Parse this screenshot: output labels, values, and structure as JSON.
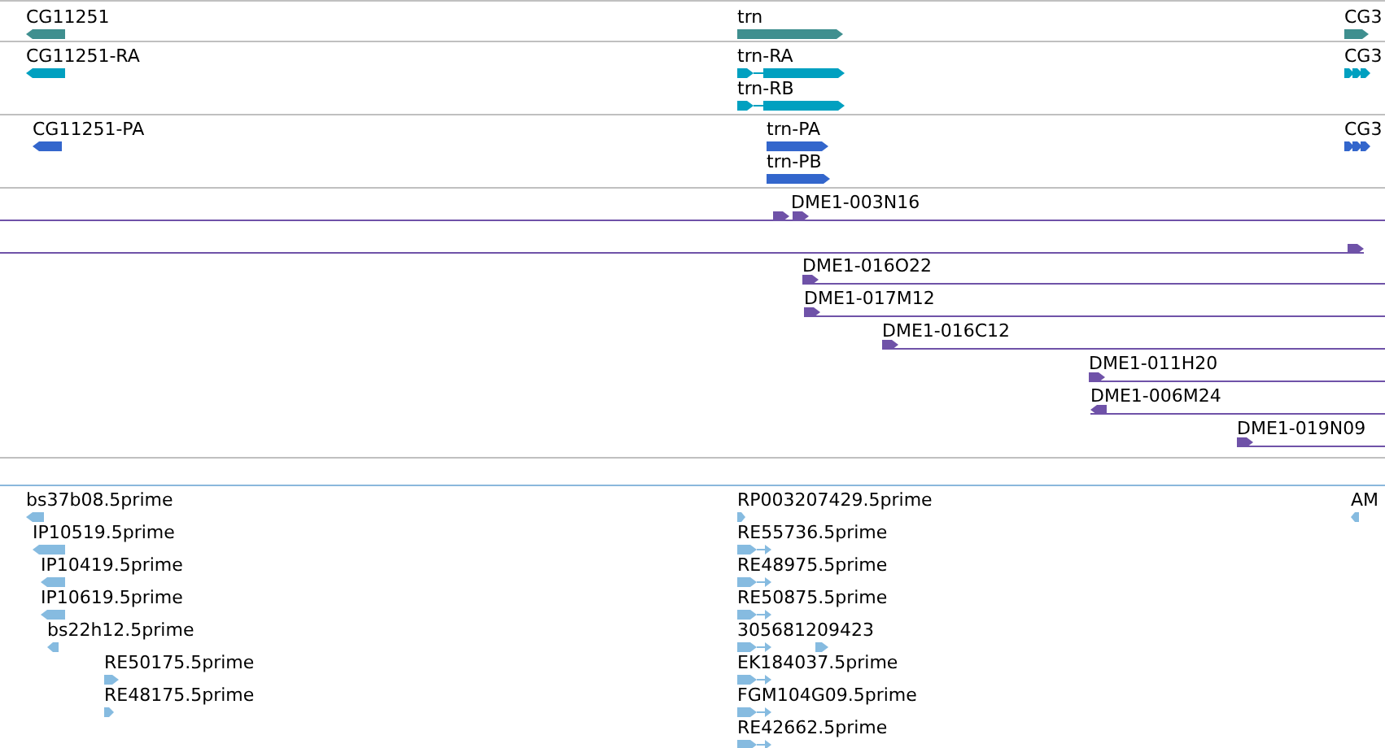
{
  "tracks": [
    {
      "kind": "gene",
      "color": "#3f8f8f",
      "features": [
        {
          "label": "CG11251",
          "reverse": true
        },
        {
          "label": "trn",
          "reverse": false
        },
        {
          "label": "CG3",
          "reverse": false
        }
      ]
    },
    {
      "kind": "transcript",
      "color": "#00a0c0",
      "features": [
        {
          "label": "CG11251-RA",
          "reverse": true
        },
        {
          "label": "trn-RA",
          "reverse": false
        },
        {
          "label": "trn-RB",
          "reverse": false
        },
        {
          "label": "CG3",
          "reverse": false
        }
      ]
    },
    {
      "kind": "protein",
      "color": "#3366cc",
      "features": [
        {
          "label": "CG11251-PA",
          "reverse": true
        },
        {
          "label": "trn-PA",
          "reverse": false
        },
        {
          "label": "trn-PB",
          "reverse": false
        },
        {
          "label": "CG3",
          "reverse": false
        }
      ]
    },
    {
      "kind": "clone",
      "color": "#6f52a8",
      "features": [
        {
          "label": "DME1-003N16",
          "reverse": false
        },
        {
          "reverse": false
        },
        {
          "label": "DME1-016O22",
          "reverse": false
        },
        {
          "label": "DME1-017M12",
          "reverse": false
        },
        {
          "label": "DME1-016C12",
          "reverse": false
        },
        {
          "label": "DME1-011H20",
          "reverse": false
        },
        {
          "label": "DME1-006M24",
          "reverse": true
        },
        {
          "label": "DME1-019N09",
          "reverse": false
        }
      ]
    },
    {
      "kind": "est",
      "color": "#86bbe0",
      "features": [
        {
          "label": "bs37b08.5prime",
          "reverse": true
        },
        {
          "label": "IP10519.5prime",
          "reverse": true
        },
        {
          "label": "IP10419.5prime",
          "reverse": true
        },
        {
          "label": "IP10619.5prime",
          "reverse": true
        },
        {
          "label": "bs22h12.5prime",
          "reverse": true
        },
        {
          "label": "RE50175.5prime",
          "reverse": false
        },
        {
          "label": "RE48175.5prime",
          "reverse": false
        },
        {
          "label": "RP003207429.5prime",
          "reverse": false
        },
        {
          "label": "RE55736.5prime",
          "reverse": false
        },
        {
          "label": "RE48975.5prime",
          "reverse": false
        },
        {
          "label": "RE50875.5prime",
          "reverse": false
        },
        {
          "label": "305681209423",
          "reverse": false
        },
        {
          "label": "EK184037.5prime",
          "reverse": false
        },
        {
          "label": "FGM104G09.5prime",
          "reverse": false
        },
        {
          "label": "RE42662.5prime",
          "reverse": false
        },
        {
          "label": "AM",
          "reverse": true
        }
      ]
    }
  ]
}
